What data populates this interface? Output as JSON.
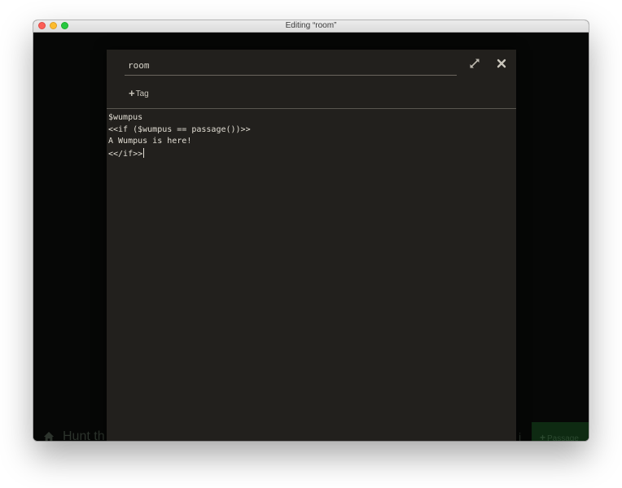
{
  "window": {
    "title": "Editing “room”"
  },
  "background_app": {
    "story_title": "Hunt th",
    "story_meta": "i",
    "add_passage_label": "Passage"
  },
  "editor": {
    "passage_name": "room",
    "add_tag_label": "Tag",
    "text_lines": [
      "$wumpus",
      "<<if ($wumpus == passage())>>",
      "A Wumpus is here!",
      "<</if>>"
    ]
  },
  "icons": {
    "maximize": "expand-arrows-icon",
    "close": "close-icon",
    "home": "home-icon",
    "plus": "plus-icon"
  },
  "colors": {
    "editor_bg": "#22201d",
    "app_bg": "#060706",
    "passage_button": "#0e2a12"
  }
}
